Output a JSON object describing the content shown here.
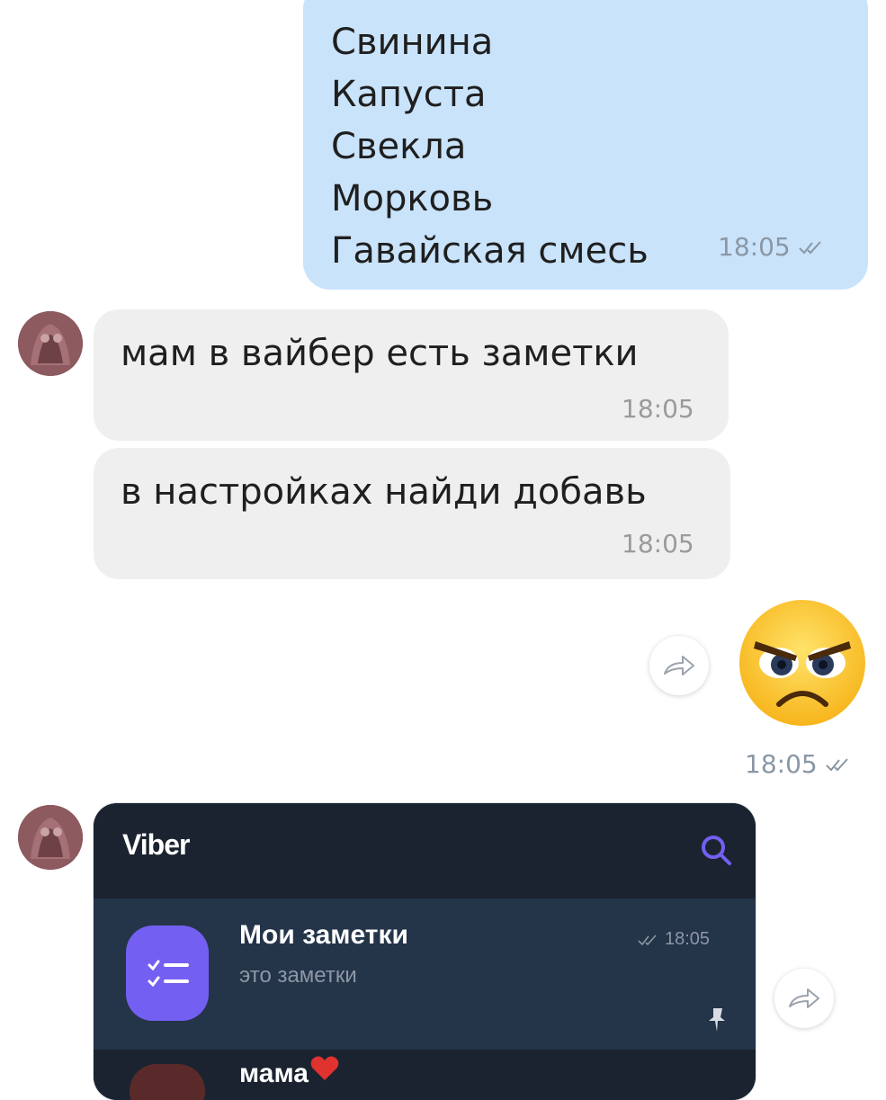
{
  "outgoing_message": {
    "lines": [
      "Свинина",
      "Капуста",
      "Свекла",
      "Морковь",
      "Гавайская смесь"
    ],
    "time": "18:05",
    "status_icon": "double-check-icon"
  },
  "incoming_messages": [
    {
      "text": "мам в вайбер есть заметки",
      "time": "18:05"
    },
    {
      "text": "в настройках найди добавь",
      "time": "18:05"
    }
  ],
  "emoji_message": {
    "emoji": "angry-face",
    "time": "18:05",
    "status_icon": "double-check-icon"
  },
  "viber_screenshot": {
    "app_title": "Viber",
    "search_icon": "search-icon",
    "chats": [
      {
        "name": "Мои заметки",
        "preview": "это заметки",
        "time": "18:05",
        "pinned": true
      }
    ],
    "next_row_partial": "мама"
  },
  "colors": {
    "outgoing_bubble": "#c9e3fb",
    "incoming_bubble": "#efefef",
    "viber_accent": "#7360f2",
    "viber_dark": "#1b2330",
    "viber_row": "#243449"
  }
}
